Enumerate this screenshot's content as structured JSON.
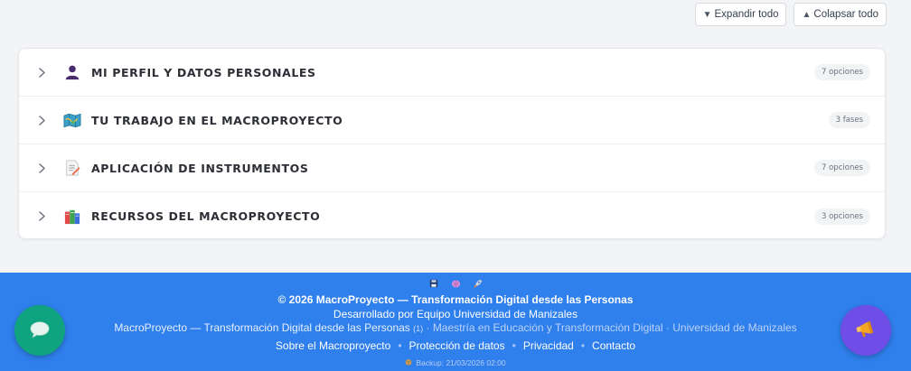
{
  "toolbar": {
    "expand_label": "Expandir todo",
    "collapse_label": "Colapsar todo",
    "expand_icon": "triangle-down-icon",
    "collapse_icon": "triangle-up-icon"
  },
  "sections": [
    {
      "title": "MI PERFIL Y DATOS PERSONALES",
      "badge": "7 opciones",
      "icon": "person-icon"
    },
    {
      "title": "TU TRABAJO EN EL MACROPROYECTO",
      "badge": "3 fases",
      "icon": "map-icon"
    },
    {
      "title": "APLICACIÓN DE INSTRUMENTOS",
      "badge": "7 opciones",
      "icon": "memo-icon"
    },
    {
      "title": "RECURSOS DEL MACROPROYECTO",
      "badge": "3 opciones",
      "icon": "books-icon"
    }
  ],
  "footer": {
    "copyright": "© 2026 MacroProyecto — Transformación Digital desde las Personas",
    "developed_by": "Desarrollado por Equipo Universidad de Manizales",
    "tagline_main": "MacroProyecto — Transformación Digital desde las Personas",
    "tagline_count": "(1)",
    "tagline_rest": "· Maestría en Educación y Transformación Digital · Universidad de Manizales",
    "links": [
      "Sobre el Macroproyecto",
      "Protección de datos",
      "Privacidad",
      "Contacto"
    ],
    "link_separator": "•",
    "backup": "Backup: 21/03/2026 02:00"
  },
  "colors": {
    "footer_bg": "#2f7fec",
    "chat_fab": "#10a37f",
    "announce_fab": "#6e4ee6"
  }
}
